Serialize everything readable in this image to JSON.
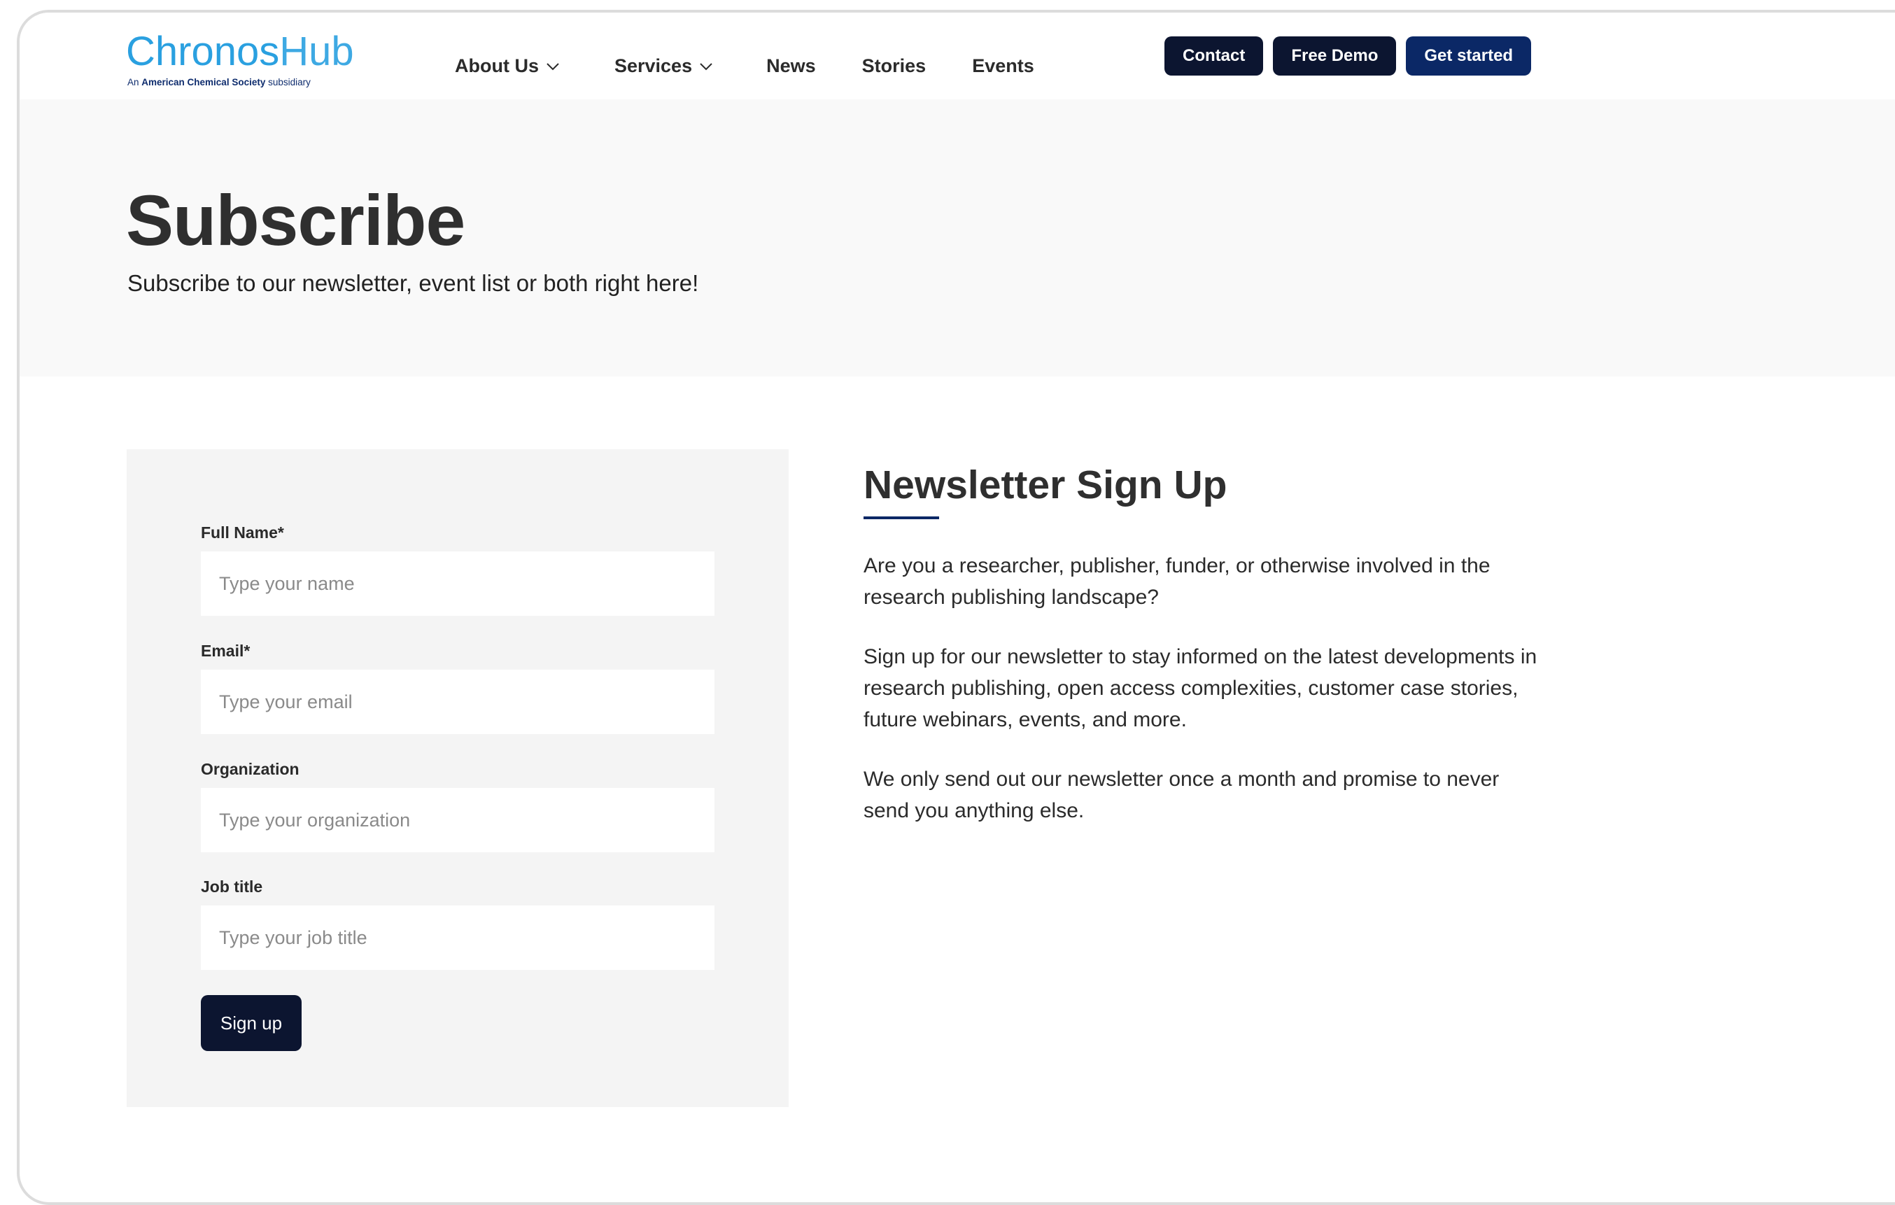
{
  "header": {
    "logo": {
      "name_part1": "Chronos",
      "name_part2": "Hub",
      "tagline_prefix": "An ",
      "tagline_bold": "American Chemical Society",
      "tagline_suffix": " subsidiary"
    },
    "nav": [
      {
        "label": "About Us",
        "dropdown": true
      },
      {
        "label": "Services",
        "dropdown": true
      },
      {
        "label": "News",
        "dropdown": false
      },
      {
        "label": "Stories",
        "dropdown": false
      },
      {
        "label": "Events",
        "dropdown": false
      }
    ],
    "buttons": {
      "contact": "Contact",
      "free_demo": "Free Demo",
      "get_started": "Get started"
    }
  },
  "hero": {
    "title": "Subscribe",
    "subtitle": "Subscribe to our newsletter, event list or both right here!"
  },
  "form": {
    "fields": [
      {
        "label": "Full Name*",
        "placeholder": "Type your name",
        "value": ""
      },
      {
        "label": "Email*",
        "placeholder": "Type your email",
        "value": ""
      },
      {
        "label": "Organization",
        "placeholder": "Type your organization",
        "value": ""
      },
      {
        "label": "Job title",
        "placeholder": "Type your job title",
        "value": ""
      }
    ],
    "submit_label": "Sign up"
  },
  "newsletter": {
    "title": "Newsletter Sign Up",
    "paragraphs": [
      "Are you a researcher, publisher, funder, or otherwise involved in the research publishing landscape?",
      "Sign up for our newsletter to stay informed on the latest developments in research publishing, open access complexities, customer case stories, future webinars, events, and more.",
      "We only send out our newsletter once a month and promise to never send you anything else."
    ]
  },
  "colors": {
    "logo_blue": "#2aa0e0",
    "navy": "#0c1530",
    "brand_navy": "#0b2866",
    "hero_bg": "#f9f9f9",
    "form_bg": "#f4f4f4"
  },
  "icons": {
    "dropdown": "chevron-down-icon"
  }
}
